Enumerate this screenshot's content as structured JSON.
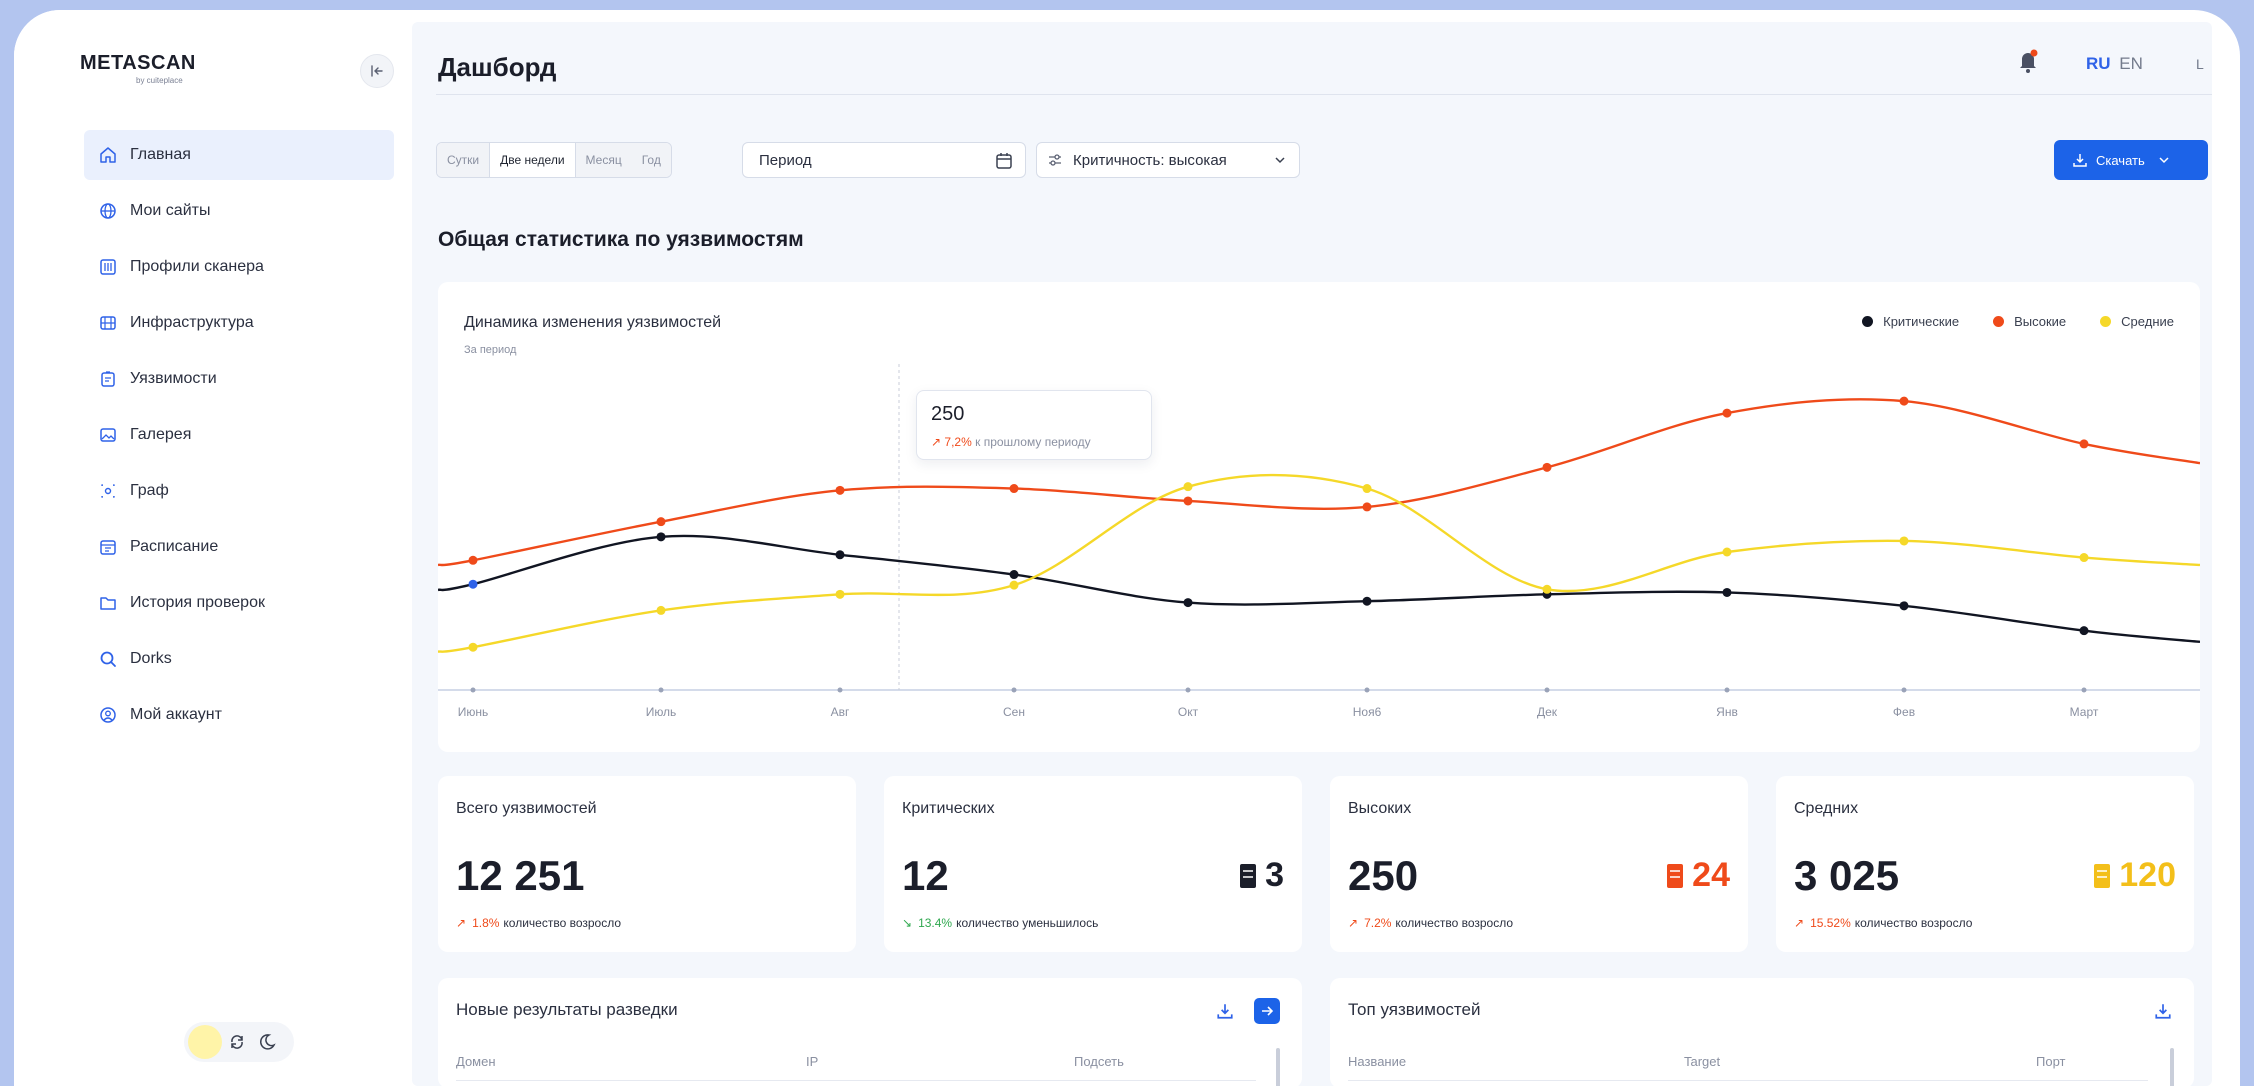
{
  "brand": {
    "name": "METASCAN",
    "sub": "by cuiteplace"
  },
  "sidebar": {
    "items": [
      {
        "label": "Главная",
        "icon": "home-icon",
        "active": true
      },
      {
        "label": "Мои сайты",
        "icon": "globe-icon"
      },
      {
        "label": "Профили сканера",
        "icon": "sliders-icon"
      },
      {
        "label": "Инфраструктура",
        "icon": "server-icon"
      },
      {
        "label": "Уязвимости",
        "icon": "clipboard-icon"
      },
      {
        "label": "Галерея",
        "icon": "gallery-icon"
      },
      {
        "label": "Граф",
        "icon": "graph-icon"
      },
      {
        "label": "Расписание",
        "icon": "calendar-icon"
      },
      {
        "label": "История проверок",
        "icon": "folder-icon"
      },
      {
        "label": "Dorks",
        "icon": "search-icon"
      },
      {
        "label": "Мой аккаунт",
        "icon": "user-icon"
      }
    ]
  },
  "header": {
    "title": "Дашборд",
    "lang_ru": "RU",
    "lang_en": "EN",
    "user_initial": "L"
  },
  "filters": {
    "ranges": [
      "Сутки",
      "Две недели",
      "Месяц",
      "Год"
    ],
    "active_range": "Две недели",
    "period_placeholder": "Период",
    "criticality": "Критичность: высокая",
    "download_label": "Скачать"
  },
  "section_title": "Общая статистика по уязвимостям",
  "chart": {
    "title": "Динамика изменения уязвимостей",
    "subtitle": "За период",
    "legend": [
      {
        "name": "Критические",
        "color": "#111522"
      },
      {
        "name": "Высокие",
        "color": "#ef4a1a"
      },
      {
        "name": "Средние",
        "color": "#f5d829"
      }
    ],
    "tooltip": {
      "value": "250",
      "pct": "7,2%",
      "text": "к прошлому периоду"
    }
  },
  "chart_data": {
    "type": "line",
    "x": [
      "Июнь",
      "Июль",
      "Авг",
      "Сен",
      "Окт",
      "Ноя6",
      "Дек",
      "Янв",
      "Фев",
      "Март"
    ],
    "series": [
      {
        "name": "Критические",
        "color": "#111522",
        "values": [
          230,
          333,
          294,
          251,
          190,
          193,
          208,
          212,
          183,
          129
        ]
      },
      {
        "name": "Высокие",
        "color": "#ef4a1a",
        "values": [
          282,
          366,
          434,
          438,
          411,
          398,
          484,
          602,
          628,
          535
        ]
      },
      {
        "name": "Средние",
        "color": "#f5d829",
        "values": [
          93,
          173,
          208,
          228,
          442,
          438,
          219,
          300,
          324,
          288
        ]
      }
    ],
    "ylim": [
      0,
      800
    ],
    "grid": false,
    "legend_position": "top-right"
  },
  "stats": [
    {
      "label": "Всего уязвимостей",
      "value": "12 251",
      "pct": "1.8%",
      "trend_text": "количество возросло",
      "trend": "up",
      "color": "#ef4a1a",
      "side_value": ""
    },
    {
      "label": "Критических",
      "value": "12",
      "pct": "13.4%",
      "trend_text": "количество уменьшилось",
      "trend": "down",
      "color": "#1b1e2a",
      "side_value": "3"
    },
    {
      "label": "Высоких",
      "value": "250",
      "pct": "7.2%",
      "trend_text": "количество возросло",
      "trend": "up",
      "color": "#ef4a1a",
      "side_value": "24"
    },
    {
      "label": "Средних",
      "value": "3 025",
      "pct": "15.52%",
      "trend_text": "количество возросло",
      "trend": "up",
      "color": "#f3bf1a",
      "side_value": "120"
    }
  ],
  "recon": {
    "title": "Новые результаты разведки",
    "columns": [
      "Домен",
      "IP",
      "Подсеть"
    ]
  },
  "top": {
    "title": "Топ уязвимостей",
    "columns": [
      "Название",
      "Target",
      "Порт"
    ]
  },
  "colors": {
    "accent": "#1c63e8",
    "up": "#ef4a1a",
    "down": "#2fa84f"
  }
}
